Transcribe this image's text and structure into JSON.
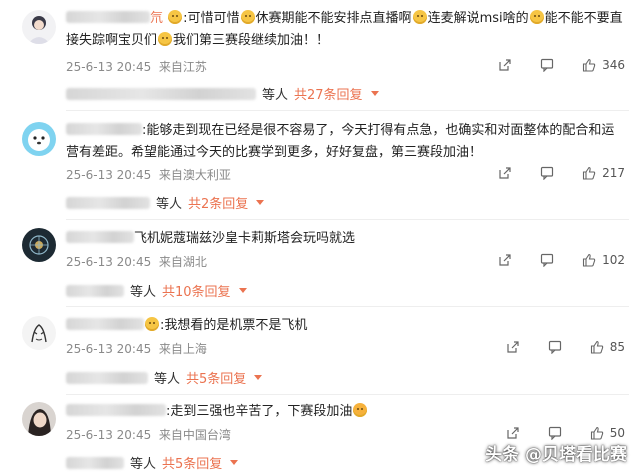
{
  "comments": [
    {
      "parts": [
        ":可惜可惜",
        "休赛期能不能安排点直播啊",
        "连麦解说msi啥的",
        "能不能不要直接失踪啊宝贝们",
        "我们第三赛段继续加油！！"
      ],
      "name_tail": "氘",
      "time": "25-6-13 20:45",
      "location": "来自江苏",
      "likes": "346",
      "reply_prefix": "等人",
      "reply_link": "共27条回复"
    },
    {
      "parts": [
        ":能够走到现在已经是很不容易了，今天打得有点急，也确实和对面整体的配合和运营有差距。希望能通过今天的比赛学到更多，好好复盘，第三赛段加油！"
      ],
      "name_tail": "",
      "time": "25-6-13 20:45",
      "location": "来自澳大利亚",
      "likes": "217",
      "reply_prefix": "等人",
      "reply_link": "共2条回复"
    },
    {
      "parts": [
        "飞机妮蔻瑞兹沙皇卡莉斯塔会玩吗就选"
      ],
      "name_tail": "",
      "time": "25-6-13 20:45",
      "location": "来自湖北",
      "likes": "102",
      "reply_prefix": "等人",
      "reply_link": "共10条回复"
    },
    {
      "parts": [
        ":我想看的是机票不是飞机"
      ],
      "name_tail": "",
      "time": "25-6-13 20:45",
      "location": "来自上海",
      "likes": "85",
      "reply_prefix": "等人",
      "reply_link": "共5条回复"
    },
    {
      "parts": [
        ":走到三强也辛苦了，下赛段加油"
      ],
      "name_tail": "",
      "time": "25-6-13 20:45",
      "location": "来自中国台湾",
      "likes": "50",
      "reply_prefix": "等人",
      "reply_link": "共5条回复"
    }
  ],
  "watermark": "头条 @贝塔看比赛",
  "colors": {
    "accent": "#eb7350",
    "meta": "#8a8a8a"
  }
}
